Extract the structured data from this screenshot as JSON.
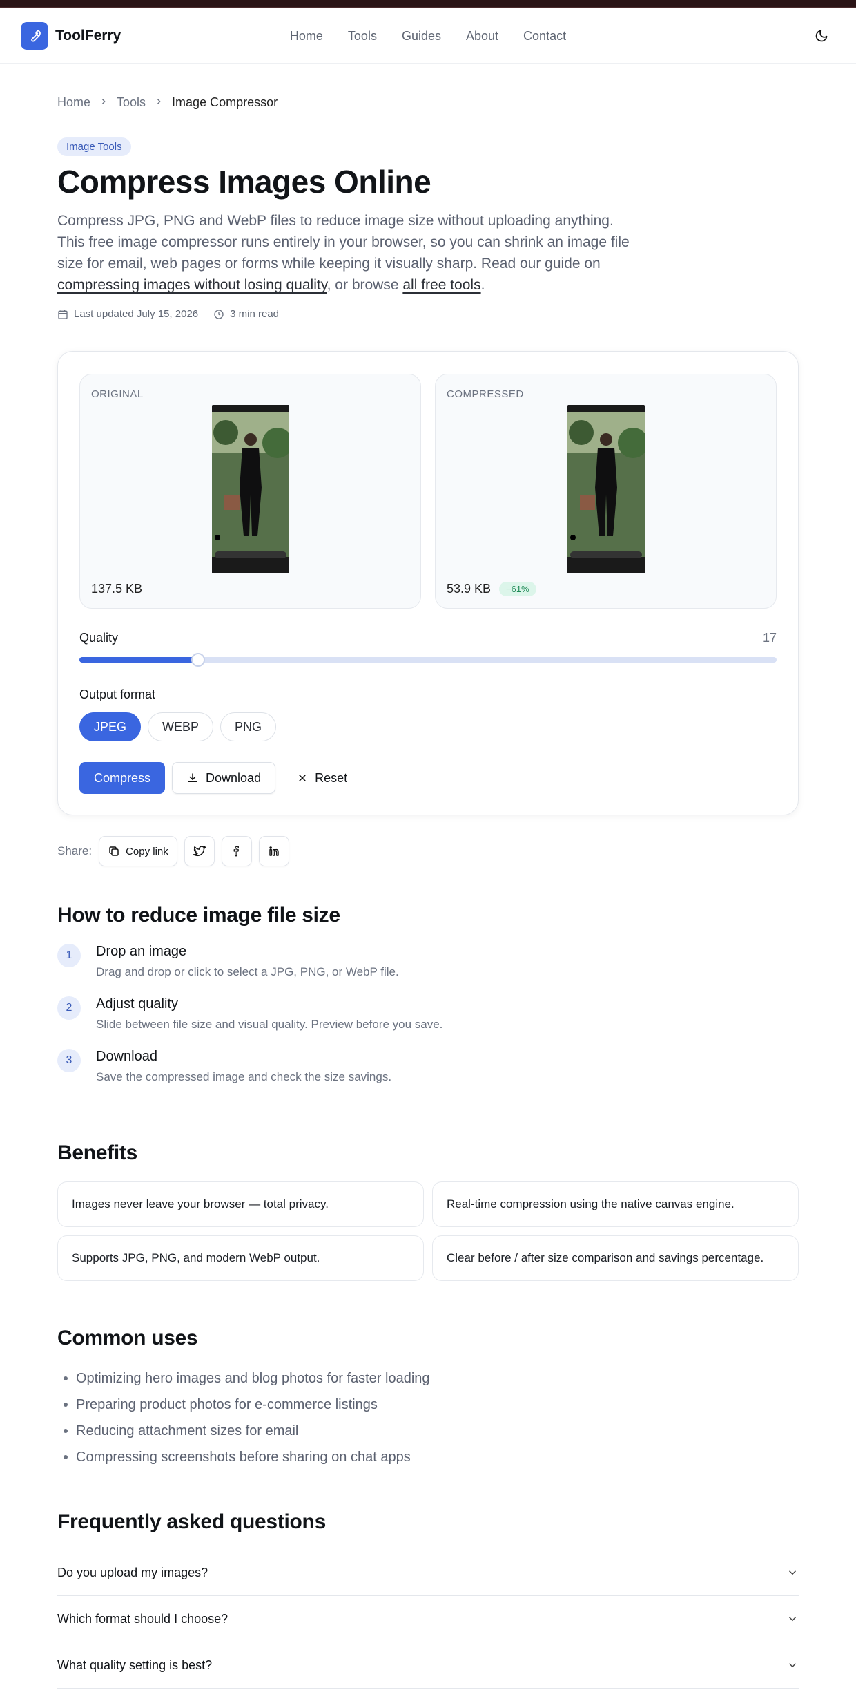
{
  "brand": {
    "name": "ToolFerry"
  },
  "nav": {
    "items": [
      "Home",
      "Tools",
      "Guides",
      "About",
      "Contact"
    ]
  },
  "breadcrumb": {
    "items": [
      "Home",
      "Tools",
      "Image Compressor"
    ]
  },
  "hero": {
    "badge": "Image Tools",
    "title": "Compress Images Online",
    "intro_text": "Compress JPG, PNG and WebP files to reduce image size without uploading anything. This free image compressor runs entirely in your browser, so you can shrink an image file size for email, web pages or forms while keeping it visually sharp. Read our guide on ",
    "intro_link1": "compressing images without losing quality",
    "intro_mid": ", or browse ",
    "intro_link2": "all free tools",
    "intro_end": ".",
    "updated": "Last updated July 15, 2026",
    "read_time": "3 min read"
  },
  "compressor": {
    "original_label": "ORIGINAL",
    "original_size": "137.5 KB",
    "compressed_label": "COMPRESSED",
    "compressed_size": "53.9 KB",
    "savings": "−61%",
    "quality_label": "Quality",
    "quality_value": "17",
    "quality_fraction": 0.17,
    "format_label": "Output format",
    "formats": [
      "JPEG",
      "WEBP",
      "PNG"
    ],
    "selected_format": "JPEG",
    "compress_label": "Compress",
    "download_label": "Download",
    "reset_label": "Reset"
  },
  "share": {
    "label": "Share:",
    "copy_label": "Copy link"
  },
  "howto": {
    "title": "How to reduce image file size",
    "steps": [
      {
        "num": "1",
        "title": "Drop an image",
        "desc": "Drag and drop or click to select a JPG, PNG, or WebP file."
      },
      {
        "num": "2",
        "title": "Adjust quality",
        "desc": "Slide between file size and visual quality. Preview before you save."
      },
      {
        "num": "3",
        "title": "Download",
        "desc": "Save the compressed image and check the size savings."
      }
    ]
  },
  "benefits": {
    "title": "Benefits",
    "items": [
      "Images never leave your browser — total privacy.",
      "Real-time compression using the native canvas engine.",
      "Supports JPG, PNG, and modern WebP output.",
      "Clear before / after size comparison and savings percentage."
    ]
  },
  "uses": {
    "title": "Common uses",
    "items": [
      "Optimizing hero images and blog photos for faster loading",
      "Preparing product photos for e-commerce listings",
      "Reducing attachment sizes for email",
      "Compressing screenshots before sharing on chat apps"
    ]
  },
  "faq": {
    "title": "Frequently asked questions",
    "items": [
      "Do you upload my images?",
      "Which format should I choose?",
      "What quality setting is best?"
    ]
  },
  "colors": {
    "accent": "#3a66e0",
    "badge_bg": "#e6ecfb",
    "savings_bg": "#dcf5ea",
    "savings_text": "#1f8a57"
  }
}
